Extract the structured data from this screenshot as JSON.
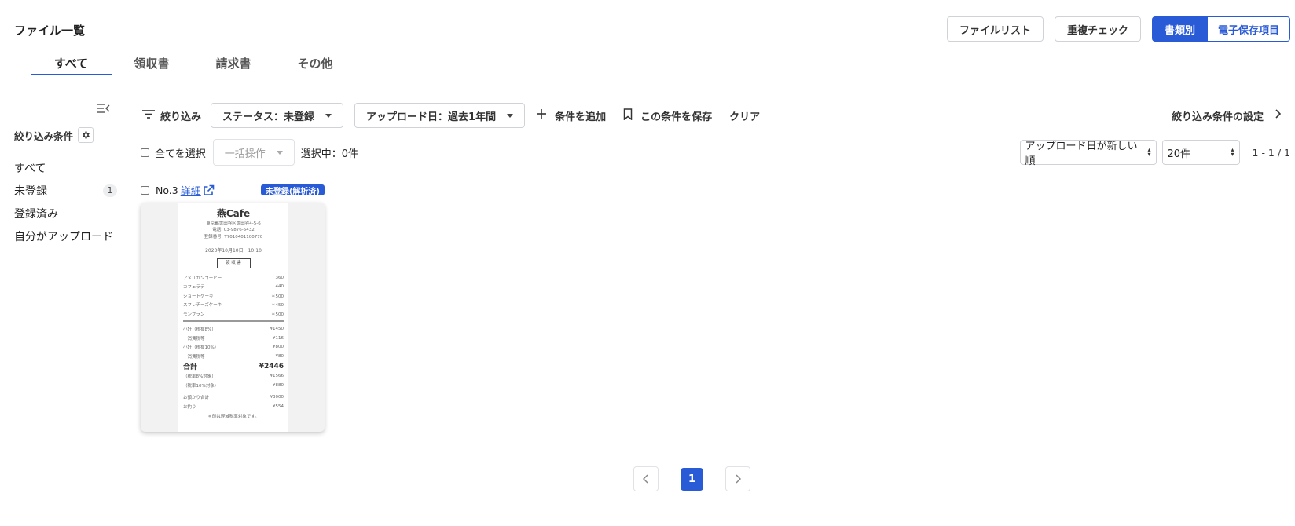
{
  "page_title": "ファイル一覧",
  "top_actions": {
    "file_list": "ファイルリスト",
    "duplicate_check": "重複チェック",
    "by_document_type": "書類別",
    "e_storage_items": "電子保存項目"
  },
  "tabs": [
    "すべて",
    "領収書",
    "請求書",
    "その他"
  ],
  "sidebar": {
    "filter_title": "絞り込み条件",
    "items": [
      {
        "label": "すべて",
        "count": ""
      },
      {
        "label": "未登録",
        "count": "1"
      },
      {
        "label": "登録済み",
        "count": ""
      },
      {
        "label": "自分がアップロード",
        "count": ""
      }
    ]
  },
  "filterbar": {
    "filter_label": "絞り込み",
    "status_dropdown": "ステータス：未登録",
    "upload_date_dropdown": "アップロード日：過去1年間",
    "add_condition": "条件を追加",
    "save_condition": "この条件を保存",
    "clear": "クリア",
    "filter_settings": "絞り込み条件の設定"
  },
  "selection": {
    "select_all": "全てを選択",
    "bulk_action": "一括操作",
    "selected_count": "選択中：0件"
  },
  "sort": {
    "order": "アップロード日が新しい順",
    "per_page": "20件",
    "range": "1 - 1 / 1"
  },
  "card": {
    "number": "No.3",
    "detail_link": "詳細",
    "status_badge": "未登録(解析済)",
    "receipt": {
      "shop_name": "燕Cafe",
      "address": "東京都世田谷区世田谷4-5-6",
      "phone": "電話: 03-9876-5432",
      "registration": "登録番号: T7010401100770",
      "datetime": "2023年10月10日　10:10",
      "stamp": "領 収 書",
      "items": [
        {
          "name": "アメリカンコーヒー",
          "price": "360"
        },
        {
          "name": "カフェラテ",
          "price": "440"
        },
        {
          "name": "ショートケーキ",
          "price": "＊500"
        },
        {
          "name": "スフレチーズケーキ",
          "price": "＊450"
        },
        {
          "name": "モンブラン",
          "price": "＊500"
        }
      ],
      "subtotals": [
        {
          "name": "小計（税抜8%）",
          "price": "¥1450"
        },
        {
          "name": "　消費税等",
          "price": "¥116"
        },
        {
          "name": "小計（税抜10%）",
          "price": "¥800"
        },
        {
          "name": "　消費税等",
          "price": "¥80"
        }
      ],
      "total_label": "合計",
      "total_value": "¥2446",
      "tax_breakdown": [
        {
          "name": "（税率8%対象）",
          "price": "¥1566"
        },
        {
          "name": "（税率10%対象）",
          "price": "¥880"
        }
      ],
      "payment": [
        {
          "name": "お預かり合計",
          "price": "¥3000"
        },
        {
          "name": "お釣り",
          "price": "¥554"
        }
      ],
      "note": "＊印は軽減税率対象です。"
    }
  },
  "pagination": {
    "current_page": "1"
  },
  "colors": {
    "accent": "#2a5bd7",
    "border": "#cfd3d8",
    "badge_bg": "#eceef0"
  }
}
